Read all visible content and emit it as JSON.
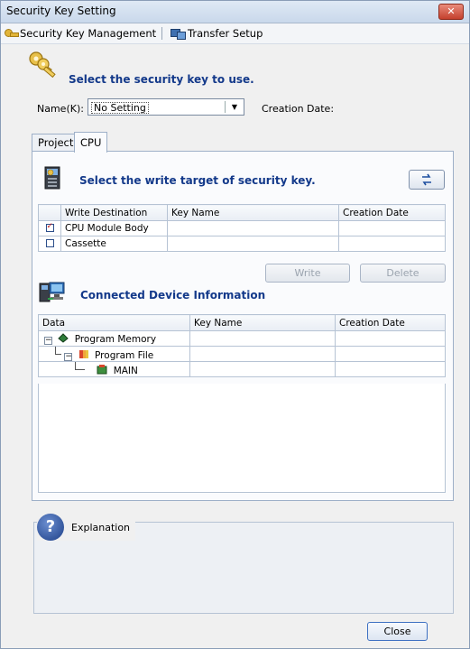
{
  "window": {
    "title": "Security Key Setting"
  },
  "menu": {
    "items": [
      {
        "label": "Security Key Management",
        "icon": "key-icon"
      },
      {
        "label": "Transfer Setup",
        "icon": "transfer-icon"
      }
    ]
  },
  "key_select": {
    "heading": "Select the security key to use.",
    "name_label": "Name(K):",
    "name_value": "No Setting",
    "creation_date_label": "Creation Date:"
  },
  "tabs": [
    {
      "label": "Project",
      "active": false
    },
    {
      "label": "CPU",
      "active": true
    }
  ],
  "write_target": {
    "heading": "Select the write target of security key.",
    "columns": [
      "Write Destination",
      "Key Name",
      "Creation Date"
    ],
    "rows": [
      {
        "checked": true,
        "destination": "CPU Module Body",
        "key_name": "",
        "creation_date": ""
      },
      {
        "checked": false,
        "destination": "Cassette",
        "key_name": "",
        "creation_date": ""
      }
    ]
  },
  "actions": {
    "write_label": "Write",
    "delete_label": "Delete"
  },
  "connected": {
    "heading": "Connected Device Information",
    "columns": [
      "Data",
      "Key Name",
      "Creation Date"
    ],
    "rows": [
      {
        "label": "Program Memory",
        "level": 0,
        "key_name": "",
        "creation_date": ""
      },
      {
        "label": "Program File",
        "level": 1,
        "key_name": "",
        "creation_date": ""
      },
      {
        "label": "MAIN",
        "level": 2,
        "key_name": "",
        "creation_date": ""
      }
    ]
  },
  "explanation": {
    "label": "Explanation"
  },
  "footer": {
    "close_label": "Close"
  }
}
